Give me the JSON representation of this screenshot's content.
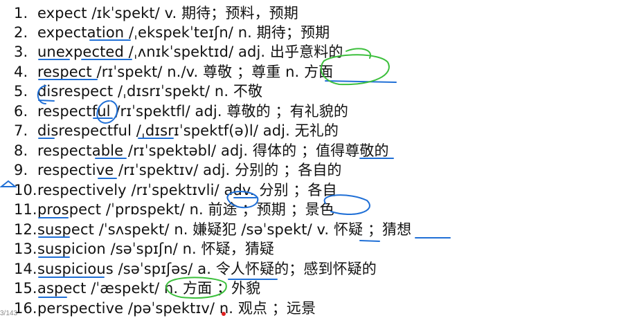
{
  "entries": [
    {
      "num": "1.",
      "text": "expect  /ɪkˈspekt/ v. 期待；预料，预期"
    },
    {
      "num": "2.",
      "text": "expectation  /ˌekspekˈteɪʃn/ n. 期待；预期"
    },
    {
      "num": "3.",
      "text": "unexpected  /ˌʌnɪkˈspektɪd/ adj. 出乎意料的"
    },
    {
      "num": "4.",
      "text": "respect   /rɪˈspekt/ n./v. 尊敬 ；尊重   n. 方面"
    },
    {
      "num": "5.",
      "text": "disrespect /ˌdɪsrɪˈspekt/ n. 不敬"
    },
    {
      "num": "6.",
      "text": "respectful   /rɪˈspektfl/ adj. 尊敬的 ；有礼貌的"
    },
    {
      "num": "7.",
      "text": "disrespectful /ˌdɪsrɪˈspektf(ə)l/ adj. 无礼的"
    },
    {
      "num": "8.",
      "text": "respectable /rɪˈspektəbl/ adj. 得体的 ；值得尊敬的"
    },
    {
      "num": "9.",
      "text": "respective /rɪˈspektɪv/ adj. 分别的 ；各自的"
    },
    {
      "num": "10.",
      "text": "respectively /rɪˈspektɪvli/ adv. 分别 ；各自"
    },
    {
      "num": "11.",
      "text": "prospect /ˈprɒspekt/ n. 前途 ；预期 ；景色"
    },
    {
      "num": "12.",
      "text": "suspect  /ˈsʌspekt/ n. 嫌疑犯 /səˈspekt/ v. 怀疑 ；猜想"
    },
    {
      "num": "13.",
      "text": "suspicion /səˈspɪʃn/ n. 怀疑，猜疑"
    },
    {
      "num": "14.",
      "text": "suspicious /səˈspɪʃəs/ a. 令人怀疑的；感到怀疑的"
    },
    {
      "num": "15.",
      "text": "aspect /ˈæspekt/ n. 方面 ；外貌"
    },
    {
      "num": "16.",
      "text": "perspective /pəˈspektɪv/ n. 观点 ；远景"
    }
  ],
  "page_indicator": "3/143",
  "colors": {
    "text": "#111111",
    "underline_blue": "#1f6fd6",
    "circle_green": "#3cbf3c",
    "dot_red": "#e02020"
  }
}
